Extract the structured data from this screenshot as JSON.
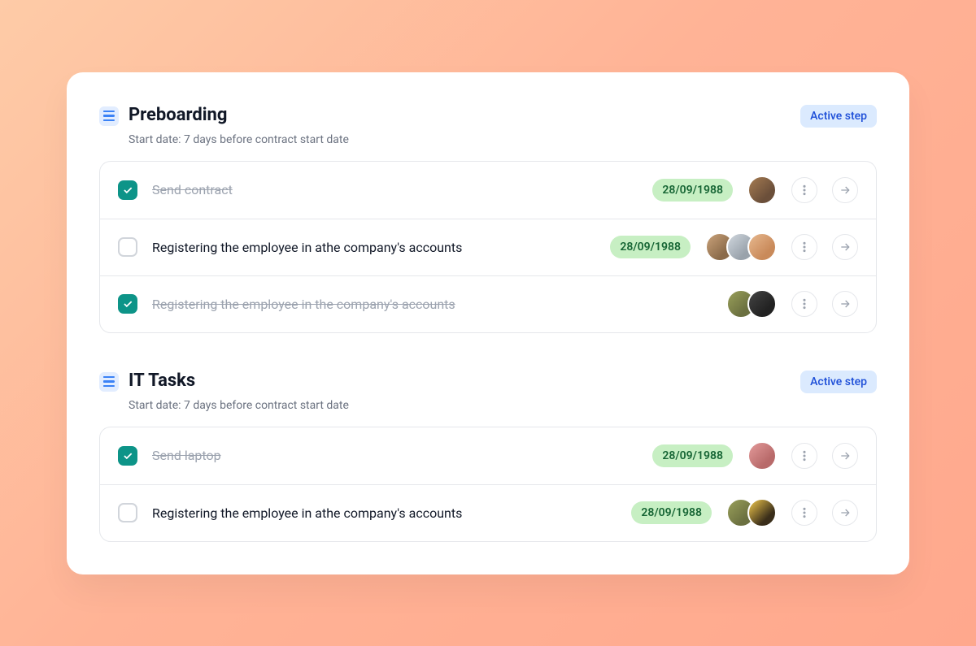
{
  "sections": [
    {
      "title": "Preboarding",
      "subtitle": "Start date: 7 days before contract start date",
      "badge": "Active step",
      "tasks": [
        {
          "checked": true,
          "title": "Send contract",
          "date": "28/09/1988",
          "avatars": [
            {
              "bg": "linear-gradient(135deg,#a67c52 0%,#6b4f3a 70%)"
            }
          ]
        },
        {
          "checked": false,
          "title": "Registering the employee in athe company's accounts",
          "date": "28/09/1988",
          "avatars": [
            {
              "bg": "linear-gradient(135deg,#caa27a 0%,#8b6b4a 70%)"
            },
            {
              "bg": "linear-gradient(135deg,#d0d7de 0%,#99a2ab 70%)"
            },
            {
              "bg": "linear-gradient(135deg,#e7b88f 0%,#c98a5a 70%)"
            }
          ]
        },
        {
          "checked": true,
          "title": "Registering the employee in the company's accounts",
          "date": "",
          "avatars": [
            {
              "bg": "linear-gradient(135deg,#9aa05a 0%,#6b7040 70%)"
            },
            {
              "bg": "linear-gradient(135deg,#444 0%,#222 70%)"
            }
          ]
        }
      ]
    },
    {
      "title": "IT Tasks",
      "subtitle": "Start date: 7 days before contract start date",
      "badge": "Active step",
      "tasks": [
        {
          "checked": true,
          "title": "Send laptop",
          "date": "28/09/1988",
          "avatars": [
            {
              "bg": "linear-gradient(135deg,#e39a9a 0%,#b86a6a 70%)"
            }
          ]
        },
        {
          "checked": false,
          "title": "Registering the employee in athe company's accounts",
          "date": "28/09/1988",
          "avatars": [
            {
              "bg": "linear-gradient(135deg,#9aa05a 0%,#6b7040 70%)"
            },
            {
              "bg": "linear-gradient(135deg,#f2c84b 0%,#3a2e1a 70%)"
            }
          ]
        }
      ]
    }
  ]
}
